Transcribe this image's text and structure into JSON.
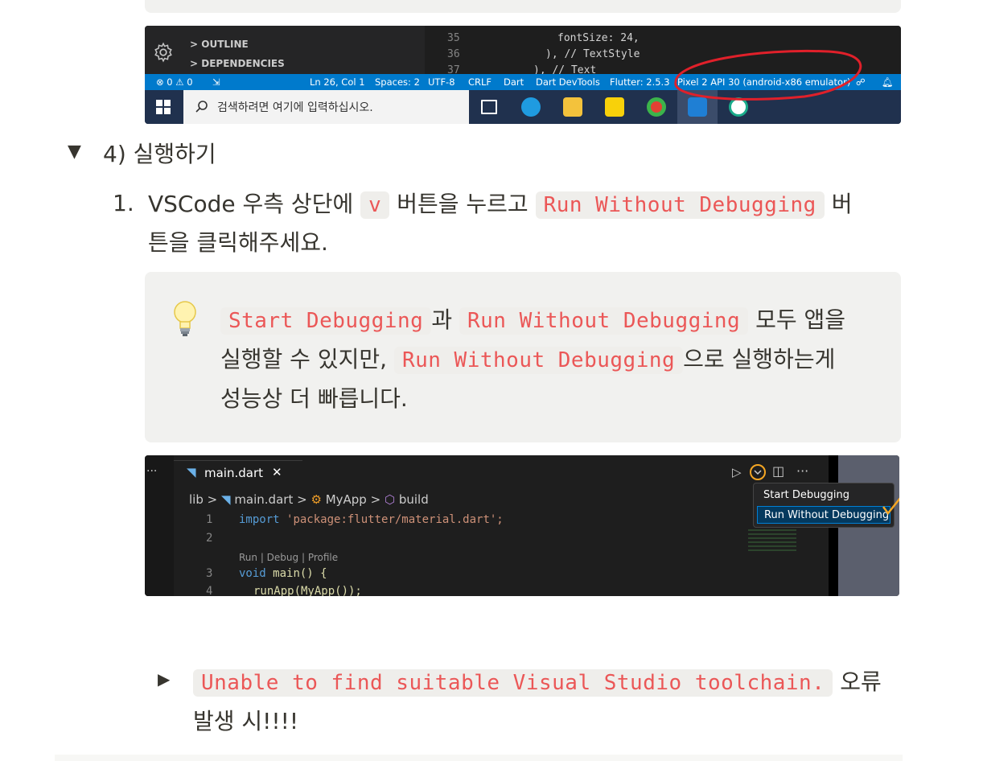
{
  "screenshot1": {
    "sidebar": {
      "outline": "OUTLINE",
      "dependencies": "DEPENDENCIES"
    },
    "code_lines": [
      {
        "num": "35",
        "text": "fontSize: 24,"
      },
      {
        "num": "36",
        "text": "), // TextStyle"
      },
      {
        "num": "37",
        "text": "), // Text"
      }
    ],
    "status_bar": {
      "problems": "⊗ 0 ⚠ 0",
      "position": "Ln 26, Col 1",
      "spaces": "Spaces: 2",
      "encoding": "UTF-8",
      "eol": "CRLF",
      "language": "Dart",
      "devtools": "Dart DevTools",
      "flutter": "Flutter: 2.5.3",
      "device": "Pixel 2 API 30 (android-x86 emulator)"
    },
    "taskbar": {
      "search_placeholder": "검색하려면 여기에 입력하십시오."
    }
  },
  "section": {
    "heading": "4) 실행하기",
    "step_number": "1.",
    "step_text_a": "VSCode 우측 상단에",
    "step_code_a": "v",
    "step_text_b": "버튼을 누르고",
    "step_code_b": "Run Without Debugging",
    "step_text_c": "버",
    "step_text_d": "튼을 클릭해주세요."
  },
  "callout": {
    "icon": "lightbulb-icon",
    "code_1": "Start Debugging",
    "text_1": "과",
    "code_2": "Run Without Debugging",
    "text_2": "모두 앱을",
    "text_3": "실행할 수 있지만,",
    "code_3": "Run Without Debugging",
    "text_4": "으로 실행하는게",
    "text_5": "성능상 더 빠릅니다."
  },
  "screenshot2": {
    "tab_label": "main.dart",
    "breadcrumb": {
      "lib": "lib",
      "file": "main.dart",
      "class": "MyApp",
      "method": "build"
    },
    "lines": [
      {
        "num": "1",
        "kw": "import",
        "rest": "'package:flutter/material.dart';"
      },
      {
        "num": "2",
        "kw": "",
        "rest": ""
      },
      {
        "num": "3",
        "kw": "void",
        "rest": "main() {"
      },
      {
        "num": "4",
        "kw": "",
        "rest": "runApp(MyApp());"
      }
    ],
    "codelens": "Run | Debug | Profile",
    "dropdown": {
      "start": "Start Debugging",
      "run_without": "Run Without Debugging"
    }
  },
  "toggle": {
    "code": "Unable to find suitable Visual Studio toolchain.",
    "text_a": "오류",
    "text_b": "발생 시!!!!"
  },
  "colors": {
    "inline_code_text": "#eb5757",
    "inline_code_bg": "#efeeeb",
    "callout_bg": "#f1f1ef",
    "vscode_status": "#007acc",
    "annotation_red": "#e0202a",
    "annotation_orange": "#f5a623"
  }
}
